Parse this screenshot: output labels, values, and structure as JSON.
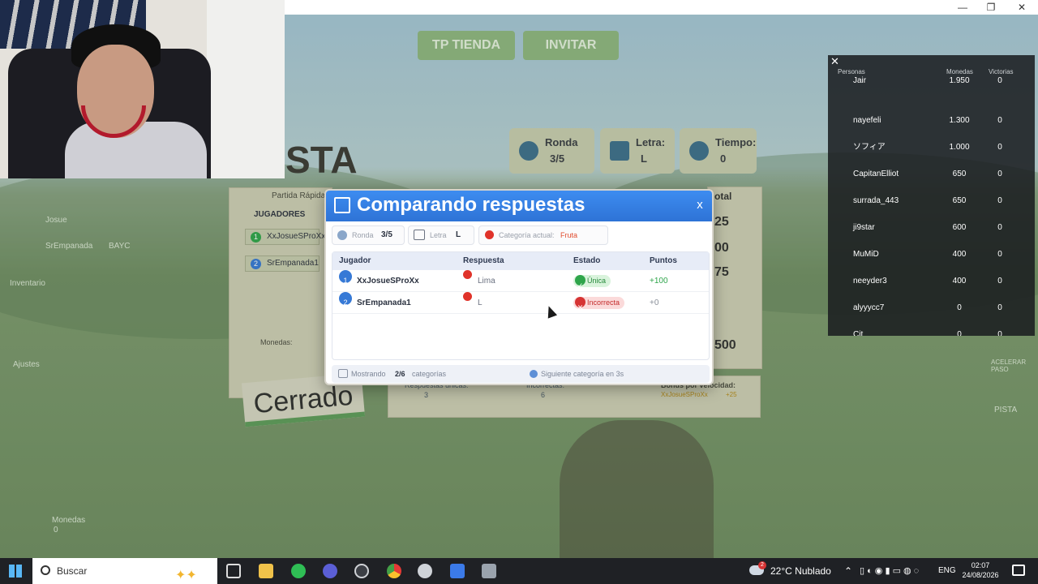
{
  "window": {
    "minimize_glyph": "—",
    "restore_glyph": "❐",
    "close_glyph": "✕"
  },
  "game": {
    "top_buttons": {
      "shop": "TP TIENDA",
      "invite": "INVITAR"
    },
    "hud": {
      "round_label": "Ronda",
      "round_value": "3/5",
      "letter_label": "Letra:",
      "letter_value": "L",
      "time_label": "Tiempo:",
      "time_value": "0"
    },
    "sign_text": "STA",
    "closed_sign": "Cerrado",
    "left_panel": {
      "title": "Partida Rápida",
      "players_header": "JUGADORES",
      "players": [
        "XxJosueSProXx",
        "SrEmpanada1"
      ],
      "coins_label": "Monedas:",
      "total_label": "otal",
      "totals": [
        "25",
        "00",
        "75",
        "500"
      ]
    },
    "side_users": [
      {
        "name": "Josue"
      },
      {
        "name": "SrEmpanada",
        "tag": "BAYC"
      }
    ],
    "side_menu": [
      "Inventario",
      "Ajustes"
    ],
    "bottom_left": {
      "label": "Monedas",
      "value": "0"
    },
    "bottom_stats": {
      "unique": "Respuestas únicas:",
      "unique_value": "3",
      "incorrect": "Incorrectas:",
      "incorrect_value": "6",
      "speed": "Bonus por velocidad:",
      "speed_player": "XxJosueSProXx",
      "speed_value": "+25"
    },
    "right_hint": "PISTA",
    "right_hint2": "ACELERAR PASO"
  },
  "leaderboard": {
    "close_glyph": "✕",
    "headers": {
      "people": "Personas",
      "coins": "Monedas",
      "wins": "Victorias"
    },
    "rows": [
      {
        "name": "Jair",
        "coins": "1.950",
        "wins": "0"
      },
      {
        "name": "nayefeli",
        "coins": "1.300",
        "wins": "0"
      },
      {
        "name": "ソフィア",
        "coins": "1.000",
        "wins": "0"
      },
      {
        "name": "CapitanElliot",
        "coins": "650",
        "wins": "0"
      },
      {
        "name": "surrada_443",
        "coins": "650",
        "wins": "0"
      },
      {
        "name": "ji9star",
        "coins": "600",
        "wins": "0"
      },
      {
        "name": "MuMiD",
        "coins": "400",
        "wins": "0"
      },
      {
        "name": "neeyder3",
        "coins": "400",
        "wins": "0"
      },
      {
        "name": "alyyycc7",
        "coins": "0",
        "wins": "0"
      },
      {
        "name": "Cit",
        "coins": "0",
        "wins": "0"
      }
    ]
  },
  "modal": {
    "title": "Comparando respuestas",
    "close": "x",
    "round_label": "Ronda",
    "round_value": "3/5",
    "letter_label": "Letra",
    "letter_value": "L",
    "category_label": "Categoría actual:",
    "category_value": "Fruta",
    "columns": {
      "player": "Jugador",
      "answer": "Respuesta",
      "status": "Estado",
      "points": "Puntos"
    },
    "rows": [
      {
        "rank": "1",
        "player": "XxJosueSProXx",
        "answer": "Lima",
        "status": "Única",
        "status_kind": "ok",
        "points": "+100",
        "points_color": "#2fa54b"
      },
      {
        "rank": "2",
        "player": "SrEmpanada1",
        "answer": "L",
        "status": "Incorrecta",
        "status_kind": "bad",
        "points": "+0",
        "points_color": "#8a8f99"
      }
    ],
    "footer": {
      "showing_label": "Mostrando",
      "showing_value": "2/6",
      "showing_suffix": "categorías",
      "next_label": "Siguiente categoría en 3s"
    }
  },
  "taskbar": {
    "search_placeholder": "Buscar",
    "weather": "22°C  Nublado",
    "weather_badge": "2",
    "language": "ENG",
    "time": "02:07",
    "date": "24/08/2026"
  }
}
